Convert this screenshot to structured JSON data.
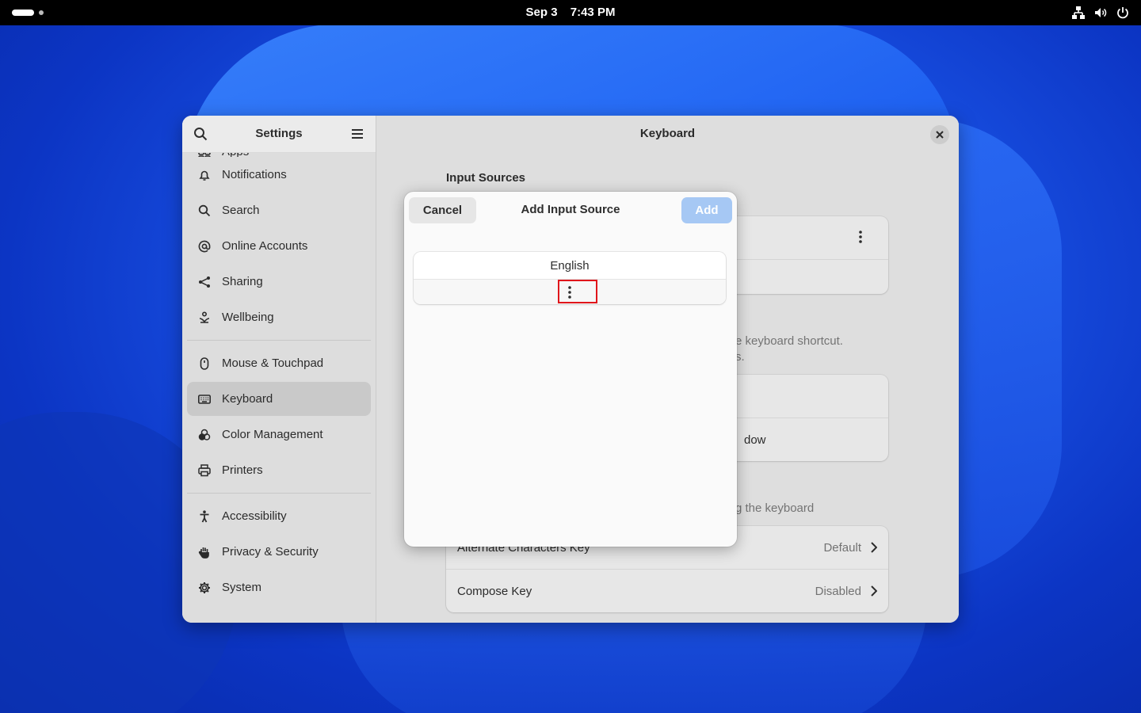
{
  "topbar": {
    "date": "Sep 3",
    "time": "7:43 PM",
    "tray_icons": [
      "network-icon",
      "volume-icon",
      "power-icon"
    ]
  },
  "settings": {
    "sidebar_title": "Settings",
    "items": [
      {
        "label": "Apps",
        "icon": "apps-icon"
      },
      {
        "label": "Notifications",
        "icon": "bell-icon"
      },
      {
        "label": "Search",
        "icon": "search-icon"
      },
      {
        "label": "Online Accounts",
        "icon": "at-icon"
      },
      {
        "label": "Sharing",
        "icon": "share-icon"
      },
      {
        "label": "Wellbeing",
        "icon": "wellbeing-icon"
      },
      {
        "label": "Mouse & Touchpad",
        "icon": "mouse-icon"
      },
      {
        "label": "Keyboard",
        "icon": "keyboard-icon",
        "active": true
      },
      {
        "label": "Color Management",
        "icon": "color-icon"
      },
      {
        "label": "Printers",
        "icon": "printer-icon"
      },
      {
        "label": "Accessibility",
        "icon": "accessibility-icon"
      },
      {
        "label": "Privacy & Security",
        "icon": "hand-icon"
      },
      {
        "label": "System",
        "icon": "gear-icon"
      }
    ]
  },
  "keyboard_page": {
    "title": "Keyboard",
    "input_sources_heading": "Input Sources",
    "partial_text_1": "e keyboard shortcut.",
    "partial_text_2": "s.",
    "partial_row_label": "dow",
    "partial_text_3": "g the keyboard",
    "rows": [
      {
        "label": "Alternate Characters Key",
        "value": "Default"
      },
      {
        "label": "Compose Key",
        "value": "Disabled"
      }
    ]
  },
  "dialog": {
    "title": "Add Input Source",
    "cancel_label": "Cancel",
    "add_label": "Add",
    "add_enabled": false,
    "languages": [
      "English"
    ],
    "more_icon": "more-vertical-icon"
  },
  "colors": {
    "accent_disabled": "#a6c8f4",
    "highlight": "#e0161b",
    "topbar": "#000000"
  }
}
